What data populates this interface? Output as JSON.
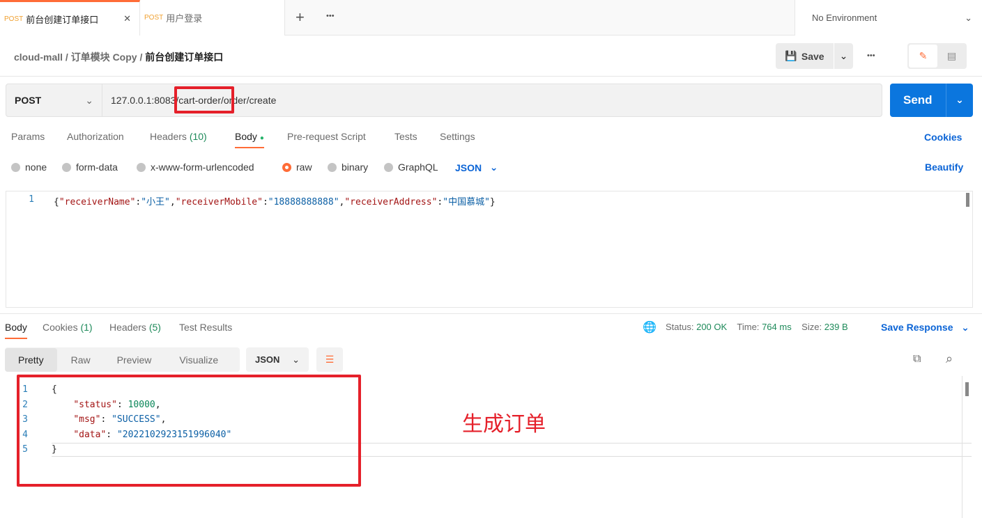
{
  "tabs": [
    {
      "method": "POST",
      "title": "前台创建订单接口",
      "active": true
    },
    {
      "method": "POST",
      "title": "用户登录",
      "active": false
    }
  ],
  "environment": "No Environment",
  "breadcrumb": [
    "cloud-mall",
    "订单模块 Copy",
    "前台创建订单接口"
  ],
  "toolbar": {
    "save": "Save"
  },
  "request": {
    "method": "POST",
    "url": "127.0.0.1:8083/cart-order/order/create",
    "send": "Send"
  },
  "req_tabs": [
    {
      "label": "Params"
    },
    {
      "label": "Authorization"
    },
    {
      "label": "Headers",
      "count": "(10)"
    },
    {
      "label": "Body",
      "active": true
    },
    {
      "label": "Pre-request Script"
    },
    {
      "label": "Tests"
    },
    {
      "label": "Settings"
    }
  ],
  "cookies": "Cookies",
  "body_types": [
    "none",
    "form-data",
    "x-www-form-urlencoded",
    "raw",
    "binary",
    "GraphQL"
  ],
  "body_format": "JSON",
  "beautify": "Beautify",
  "request_body": {
    "line": "1",
    "parts": [
      [
        "p",
        "{"
      ],
      [
        "k",
        "\"receiverName\""
      ],
      [
        "p",
        ":"
      ],
      [
        "s",
        "\"小王\""
      ],
      [
        "p",
        ","
      ],
      [
        "k",
        "\"receiverMobile\""
      ],
      [
        "p",
        ":"
      ],
      [
        "s",
        "\"18888888888\""
      ],
      [
        "p",
        ","
      ],
      [
        "k",
        "\"receiverAddress\""
      ],
      [
        "p",
        ":"
      ],
      [
        "s",
        "\"中国慕城\""
      ],
      [
        "p",
        "}"
      ]
    ]
  },
  "resp_tabs": [
    {
      "label": "Body",
      "active": true
    },
    {
      "label": "Cookies",
      "count": "(1)"
    },
    {
      "label": "Headers",
      "count": "(5)"
    },
    {
      "label": "Test Results"
    }
  ],
  "status": {
    "status_label": "Status:",
    "status": "200 OK",
    "time_label": "Time:",
    "time": "764 ms",
    "size_label": "Size:",
    "size": "239 B"
  },
  "save_response": "Save Response",
  "view_modes": [
    "Pretty",
    "Raw",
    "Preview",
    "Visualize"
  ],
  "resp_format": "JSON",
  "response_lines": [
    {
      "n": "1",
      "parts": [
        [
          "p",
          "{"
        ]
      ]
    },
    {
      "n": "2",
      "parts": [
        [
          "p",
          "    "
        ],
        [
          "k",
          "\"status\""
        ],
        [
          "p",
          ": "
        ],
        [
          "n",
          "10000"
        ],
        [
          "p",
          ","
        ]
      ]
    },
    {
      "n": "3",
      "parts": [
        [
          "p",
          "    "
        ],
        [
          "k",
          "\"msg\""
        ],
        [
          "p",
          ": "
        ],
        [
          "s",
          "\"SUCCESS\""
        ],
        [
          "p",
          ","
        ]
      ]
    },
    {
      "n": "4",
      "parts": [
        [
          "p",
          "    "
        ],
        [
          "k",
          "\"data\""
        ],
        [
          "p",
          ": "
        ],
        [
          "s",
          "\"2022102923151996040\""
        ]
      ]
    },
    {
      "n": "5",
      "parts": [
        [
          "p",
          "}"
        ]
      ]
    }
  ],
  "annotation": "生成订单"
}
